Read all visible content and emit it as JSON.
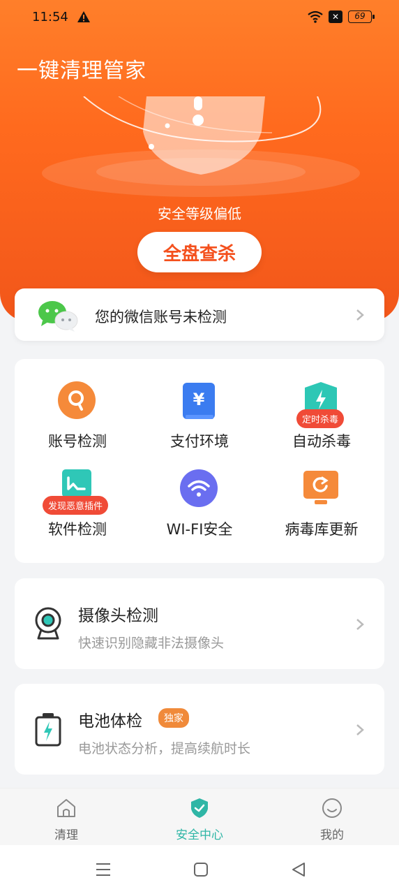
{
  "status_bar": {
    "time": "11:54",
    "battery": "69",
    "icons": [
      "warning-icon",
      "wifi-icon",
      "close-box-icon",
      "battery-icon"
    ]
  },
  "header": {
    "title": "一键清理管家",
    "security_level": "安全等级偏低",
    "scan_button": "全盘查杀"
  },
  "wechat_card": {
    "label": "您的微信账号未检测"
  },
  "grid": {
    "items": [
      {
        "label": "账号检测",
        "icon": "search-icon",
        "color": "#f58a3a"
      },
      {
        "label": "支付环境",
        "icon": "yuan-icon",
        "color": "#3b7cf0"
      },
      {
        "label": "自动杀毒",
        "icon": "lightning-shield-icon",
        "color": "#2dc7b5",
        "tag": "定时杀毒"
      },
      {
        "label": "软件检测",
        "icon": "app-scan-icon",
        "color": "#2fc7b7",
        "tag": "发现恶意插件"
      },
      {
        "label": "WI-FI安全",
        "icon": "wifi-icon",
        "color": "#6a6ef0"
      },
      {
        "label": "病毒库更新",
        "icon": "refresh-monitor-icon",
        "color": "#f58a3a"
      }
    ]
  },
  "camera_card": {
    "title": "摄像头检测",
    "subtitle": "快速识别隐藏非法摄像头"
  },
  "battery_card": {
    "title": "电池体检",
    "badge": "独家",
    "subtitle": "电池状态分析，提高续航时长"
  },
  "bottom_nav": {
    "items": [
      {
        "label": "清理",
        "icon": "home-icon",
        "active": false
      },
      {
        "label": "安全中心",
        "icon": "shield-check-icon",
        "active": true
      },
      {
        "label": "我的",
        "icon": "smile-icon",
        "active": false
      }
    ]
  },
  "colors": {
    "brand_orange": "#ff6a1e",
    "accent_teal": "#2fb6a6",
    "tag_red": "#f04b37"
  }
}
